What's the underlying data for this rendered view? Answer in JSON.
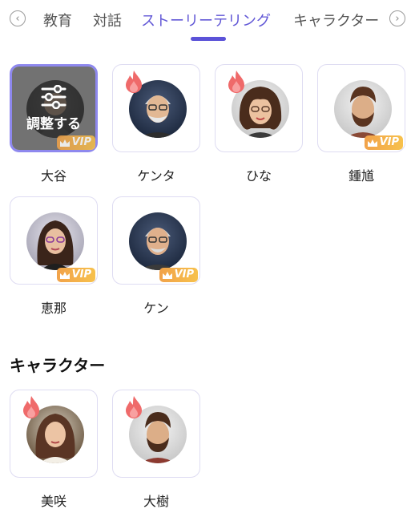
{
  "tabs": {
    "items": [
      "教育",
      "対話",
      "ストーリーテリング",
      "キャラクター"
    ],
    "active_index": 2
  },
  "adjust_label": "調整する",
  "vip_label": "VIP",
  "storytelling": [
    {
      "name": "大谷",
      "hot": false,
      "vip": true,
      "selected": true
    },
    {
      "name": "ケンタ",
      "hot": true,
      "vip": false
    },
    {
      "name": "ひな",
      "hot": true,
      "vip": false
    },
    {
      "name": "鍾馗",
      "hot": false,
      "vip": true
    },
    {
      "name": "恵那",
      "hot": false,
      "vip": true
    },
    {
      "name": "ケン",
      "hot": false,
      "vip": true
    }
  ],
  "characters_section": {
    "title": "キャラクター",
    "items": [
      {
        "name": "美咲",
        "hot": true,
        "vip": false
      },
      {
        "name": "大樹",
        "hot": true,
        "vip": false
      }
    ]
  },
  "colors": {
    "accent": "#5b52d8",
    "vip": "#f3b14b",
    "flame": "#ef5b5b"
  }
}
